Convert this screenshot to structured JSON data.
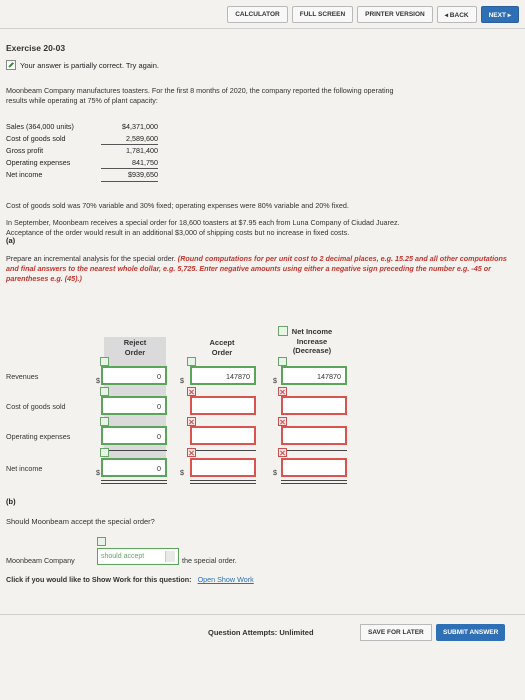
{
  "toolbar": {
    "calculator": "CALCULATOR",
    "full_screen": "FULL SCREEN",
    "printer_version": "PRINTER VERSION",
    "back": "◂ BACK",
    "next": "NEXT ▸"
  },
  "exercise": {
    "title": "Exercise 20-03",
    "status": "Your answer is partially correct.  Try again."
  },
  "intro": {
    "line1": "Moonbeam Company manufactures toasters. For the first 8 months of 2020, the company reported the following operating",
    "line2": "results while operating at 75% of plant capacity:"
  },
  "financials": [
    {
      "label": "Sales (364,000 units)",
      "value": "$4,371,000"
    },
    {
      "label": "Cost of goods sold",
      "value": "2,589,600"
    },
    {
      "label": "Gross profit",
      "value": "1,781,400"
    },
    {
      "label": "Operating expenses",
      "value": "841,750"
    },
    {
      "label": "Net income",
      "value": "$939,650"
    }
  ],
  "cost_note": "Cost of goods sold was 70% variable and 30% fixed; operating expenses were 80% variable and 20% fixed.",
  "special_order": {
    "line1": "In September, Moonbeam receives a special order for 18,600 toasters at $7.95 each from Luna Company of Ciudad Juarez.",
    "line2": "Acceptance of the order would result in an additional $3,000 of shipping costs but no increase in fixed costs."
  },
  "part_a": {
    "label": "(a)",
    "instr_plain": "Prepare an incremental analysis for the special order. ",
    "instr_red": "(Round computations for per unit cost to 2 decimal places, e.g. 15.25 and all other computations and final answers to the nearest whole dollar, e.g. 5,725. Enter negative amounts using either a negative sign preceding the number e.g. -45 or parentheses e.g. (45).)"
  },
  "table": {
    "headers": {
      "reject": [
        "Reject",
        "Order"
      ],
      "accept": [
        "Accept",
        "Order"
      ],
      "net": [
        "Net Income",
        "Increase",
        "(Decrease)"
      ]
    },
    "rows": [
      {
        "label": "Revenues",
        "reject": "0",
        "accept": "147870",
        "net": "147870"
      },
      {
        "label": "Cost of goods sold",
        "reject": "0",
        "accept": "",
        "net": ""
      },
      {
        "label": "Operating expenses",
        "reject": "0",
        "accept": "",
        "net": ""
      },
      {
        "label": "Net income",
        "reject": "0",
        "accept": "",
        "net": ""
      }
    ],
    "dollar": "$"
  },
  "part_b": {
    "label": "(b)",
    "question": "Should Moonbeam accept the special order?",
    "prefix": "Moonbeam Company",
    "selected": "should accept",
    "suffix": "the special order."
  },
  "show_work": {
    "prompt": "Click if you would like to Show Work for this question:",
    "link": "Open Show Work"
  },
  "footer": {
    "attempts": "Question Attempts: Unlimited",
    "save": "SAVE FOR LATER",
    "submit": "SUBMIT ANSWER"
  }
}
